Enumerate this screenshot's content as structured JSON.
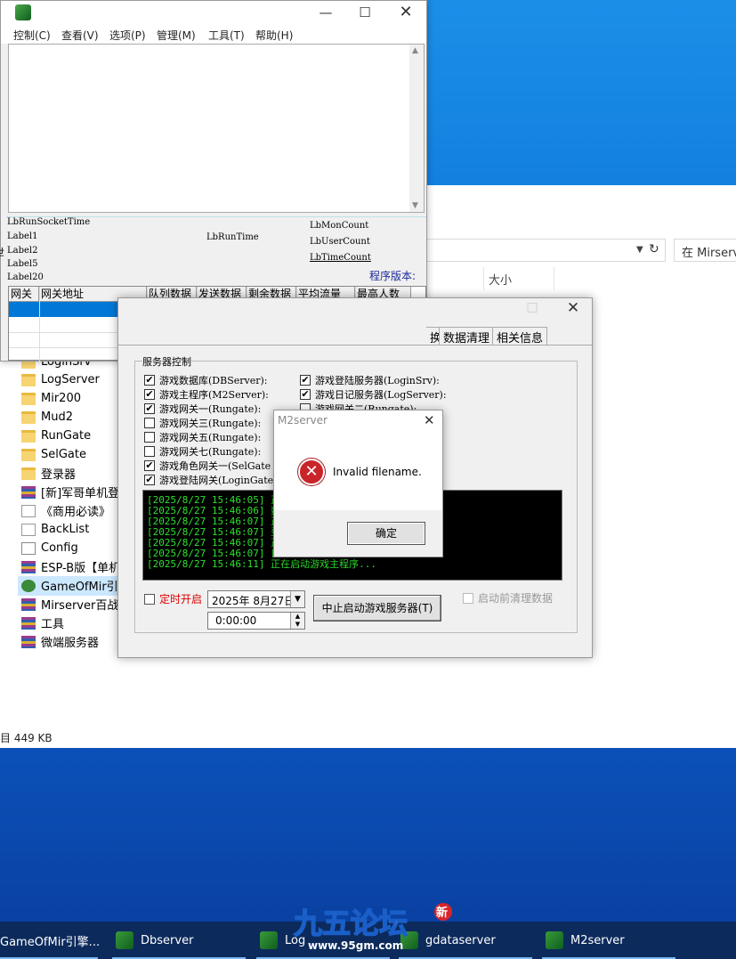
{
  "explorer": {
    "search_placeholder": "在 Mirserv",
    "size_header": "大小",
    "tree": [
      {
        "label": "LoginSrv",
        "icon": "folder-icon"
      },
      {
        "label": "LogServer",
        "icon": "folder-icon"
      },
      {
        "label": "Mir200",
        "icon": "folder-icon"
      },
      {
        "label": "Mud2",
        "icon": "folder-icon"
      },
      {
        "label": "RunGate",
        "icon": "folder-icon"
      },
      {
        "label": "SelGate",
        "icon": "folder-icon"
      },
      {
        "label": "登录器",
        "icon": "folder-icon"
      },
      {
        "label": "[新]军哥单机登录",
        "icon": "archive-icon"
      },
      {
        "label": "《商用必读》",
        "icon": "document-icon"
      },
      {
        "label": "BackList",
        "icon": "document-icon"
      },
      {
        "label": "Config",
        "icon": "config-icon"
      },
      {
        "label": "ESP-B版【单机】",
        "icon": "archive-icon"
      },
      {
        "label": "GameOfMir引擎",
        "icon": "app-icon"
      },
      {
        "label": "Mirserver百战",
        "icon": "archive-icon"
      },
      {
        "label": "工具",
        "icon": "archive-icon"
      },
      {
        "label": "微端服务器",
        "icon": "archive-icon"
      }
    ],
    "status": "目  449 KB"
  },
  "mainwin": {
    "menu": [
      "控制(C)",
      "查看(V)",
      "选项(P)",
      "管理(M)",
      "工具(T)",
      "帮助(H)"
    ],
    "labels": {
      "run_socket_time": "LbRunSocketTime",
      "label1": "Label1",
      "label2": "Label2",
      "label5": "Label5",
      "label20": "Label20",
      "run_time": "LbRunTime",
      "mon_count": "LbMonCount",
      "user_count": "LbUserCount",
      "time_count": "LbTimeCount",
      "version": "程序版本:",
      "side_fragment": "世"
    },
    "grid_headers": [
      "网关",
      "网关地址",
      "队列数据",
      "发送数据",
      "剩余数据",
      "平均流量",
      "最高人数"
    ]
  },
  "server": {
    "tabs": [
      "换",
      "数据清理",
      "相关信息"
    ],
    "group_title": "服务器控制",
    "checks_left": [
      {
        "label": "游戏数据库(DBServer):",
        "checked": true
      },
      {
        "label": "游戏主程序(M2Server):",
        "checked": true
      },
      {
        "label": "游戏网关一(Rungate):",
        "checked": true
      },
      {
        "label": "游戏网关三(Rungate):",
        "checked": false
      },
      {
        "label": "游戏网关五(Rungate):",
        "checked": false
      },
      {
        "label": "游戏网关七(Rungate):",
        "checked": false
      },
      {
        "label": "游戏角色网关一(SelGate",
        "checked": true
      },
      {
        "label": "游戏登陆网关(LoginGate",
        "checked": true
      }
    ],
    "checks_right": [
      {
        "label": "游戏登陆服务器(LoginSrv):",
        "checked": true
      },
      {
        "label": "游戏日记服务器(LogServer):",
        "checked": true
      },
      {
        "label": "游戏网关二(Rungate):",
        "checked": false
      }
    ],
    "log": [
      "[2025/8/27 15:46:05] 正在",
      "[2025/8/27 15:46:06] 数据",
      "[2025/8/27 15:46:07] 正在",
      "[2025/8/27 15:46:07] 登录",
      "[2025/8/27 15:46:07] 正在",
      "[2025/8/27 15:46:07] 日志",
      "[2025/8/27 15:46:11] 正在启动游戏主程序..."
    ],
    "timer_label": "定时开启",
    "date_value": "2025年  8月27日",
    "time_value": "0:00:00",
    "stop_button": "中止启动游戏服务器(T)",
    "clear_label": "启动前清理数据"
  },
  "dialog": {
    "title": "M2server",
    "message": "Invalid filename.",
    "ok": "确定"
  },
  "taskbar": [
    {
      "label": "GameOfMir引擎..."
    },
    {
      "label": "Dbserver"
    },
    {
      "label": "Log"
    },
    {
      "label": "gdataserver"
    },
    {
      "label": "M2server"
    }
  ],
  "watermark": {
    "text": "九五论坛",
    "url": "www.95gm.com",
    "badge": "新"
  },
  "colors": {
    "selection": "#0078d7",
    "log_text": "#2ee02e",
    "timer_red": "#d00000",
    "error_red": "#c8252b"
  }
}
